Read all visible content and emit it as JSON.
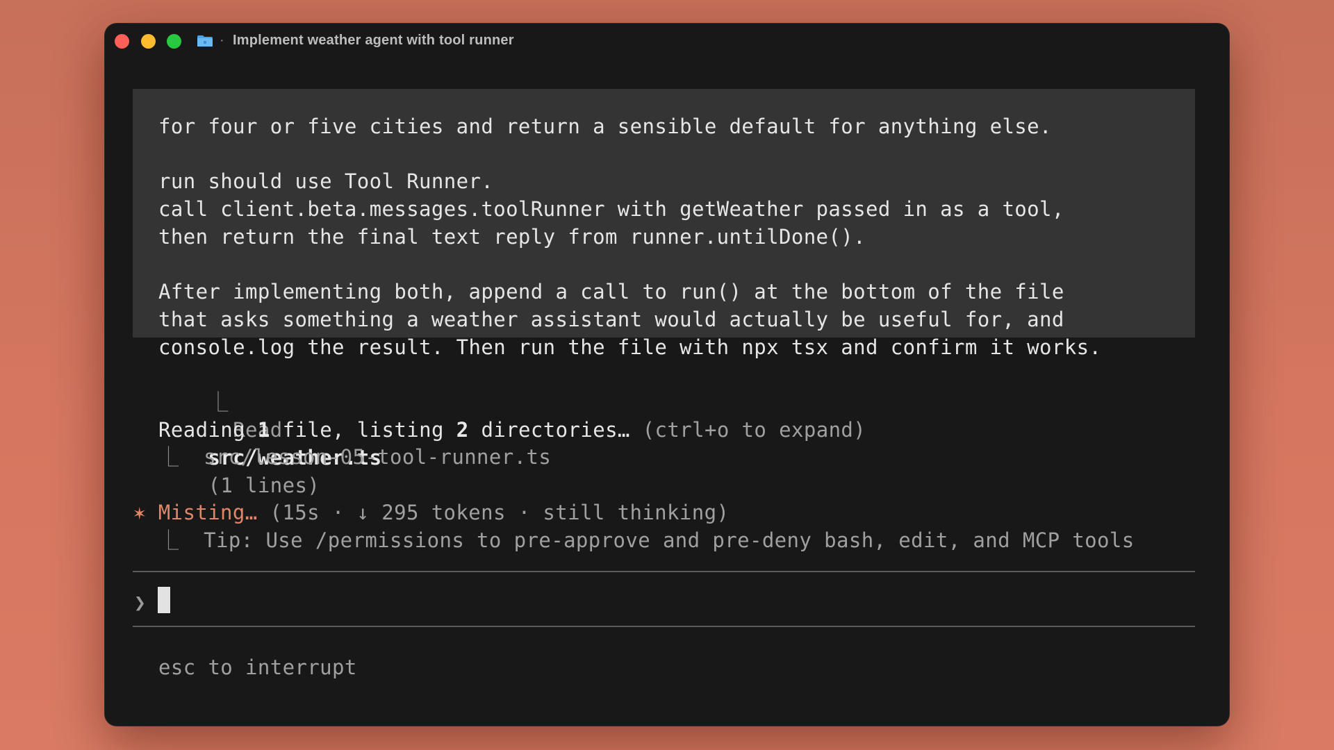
{
  "window": {
    "title_separator": "·",
    "title": "Implement weather agent with tool runner",
    "folder_icon": "folder-icon"
  },
  "prompt": {
    "lines": [
      "for four or five cities and return a sensible default for anything else.",
      "",
      "run should use Tool Runner.",
      "call client.beta.messages.toolRunner with getWeather passed in as a tool,",
      "then return the final text reply from runner.untilDone().",
      "",
      "After implementing both, append a call to run() at the bottom of the file",
      "that asks something a weather assistant would actually be useful for, and",
      "console.log the result. Then run the file with npx tsx and confirm it works."
    ]
  },
  "read_result": {
    "corner": "⎿",
    "verb": "Read",
    "file": "src/weather.ts",
    "count": "(1 lines)"
  },
  "reading_status": {
    "prefix": "Reading",
    "file_count": "1",
    "middle": "file, listing",
    "dir_count": "2",
    "suffix": "directories…",
    "hint": "(ctrl+o to expand)",
    "corner": "⎿",
    "path": "src/lesson-05-tool-runner.ts"
  },
  "thinking": {
    "star": "✶",
    "label": "Misting…",
    "details": "(15s · ↓ 295 tokens · still thinking)",
    "corner": "⎿",
    "tip": "Tip: Use /permissions to pre-approve and pre-deny bash, edit, and MCP tools"
  },
  "input": {
    "caret": "❯",
    "value": ""
  },
  "footer": {
    "hint": "esc to interrupt"
  },
  "colors": {
    "background": "#d57660",
    "window": "#181818",
    "prompt_block": "#343434",
    "accent_orange": "#e0866a",
    "close": "#fe5f57",
    "minimize": "#febc2e",
    "maximize": "#28c840"
  }
}
